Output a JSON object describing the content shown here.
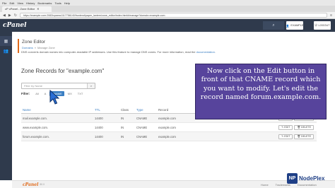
{
  "browser": {
    "menu": [
      "File",
      "Edit",
      "View",
      "History",
      "Bookmarks",
      "Tools",
      "Help"
    ],
    "tab_title": "cP cPanel - Zone Editor",
    "url": "https://example.com:2083/cpsess1117756140/frontend/paper_lantern/zone_editor/index.html#/manage?domain=example.com"
  },
  "header": {
    "logo": "cPanel",
    "user_label": "EXAMPLE",
    "logout_label": "LOGOUT"
  },
  "page": {
    "title": "Zone Editor",
    "breadcrumb": [
      "Domains",
      "»",
      "Manage Zone"
    ],
    "intro": "DNS converts domain names into computer-readable IP addresses. Use this feature to manage DNS zones. For more information, read the",
    "intro_link": "documentation",
    "intro_end": "."
  },
  "records": {
    "heading": "Zone Records for \"example.com\"",
    "filter_placeholder": "Filter by Name",
    "filter_label": "Filter:",
    "filter_options": [
      "All",
      "A",
      "CNAME",
      "MX",
      "TXT"
    ],
    "filter_active": "CNAME",
    "columns": [
      "Name",
      "TTL",
      "Class",
      "Type",
      "Record",
      "Actions"
    ],
    "rows": [
      {
        "name": "mail.example.com.",
        "ttl": "14400",
        "class": "IN",
        "type": "CNAME",
        "record": "example.com"
      },
      {
        "name": "www.example.com.",
        "ttl": "14400",
        "class": "IN",
        "type": "CNAME",
        "record": "example.com"
      },
      {
        "name": "forum.example.com.",
        "ttl": "14400",
        "class": "IN",
        "type": "CNAME",
        "record": "example.com"
      }
    ],
    "edit_label": "EDIT",
    "delete_label": "DELETE"
  },
  "overlay": {
    "text": "Now click on the Edit button in front of that CNAME record which you want to modify. Let's edit the record named forum.example.com."
  },
  "footer": {
    "logo": "cPanel",
    "version": "80.0",
    "links": [
      "Home",
      "Trademarks",
      "Documentation"
    ]
  },
  "brand": {
    "mark": "NP",
    "name": "NodePlex"
  },
  "colors": {
    "cpanel_dark": "#2f3a4c",
    "accent_orange": "#e06a1b",
    "link_blue": "#3a7ec2",
    "overlay_purple": "#57449c"
  }
}
